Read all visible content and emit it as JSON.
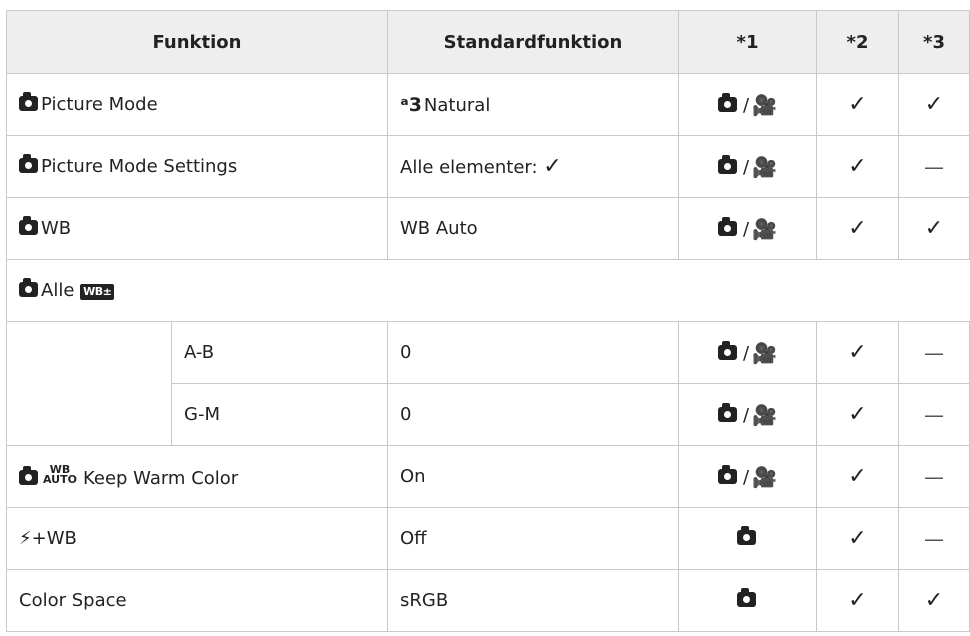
{
  "header": {
    "col1": "Funktion",
    "col2": "Standardfunktion",
    "col3": "*1",
    "col4": "*2",
    "col5": "*3"
  },
  "rows": {
    "picture_mode": {
      "label": "Picture Mode",
      "default_icon": "ᵃ3",
      "default_text": "Natural"
    },
    "picture_mode_settings": {
      "label": "Picture Mode Settings",
      "default_text": "Alle elementer:"
    },
    "wb": {
      "label": "WB",
      "default_text": "WB Auto"
    },
    "all_wb": {
      "label": "Alle",
      "icon_text": "WB±"
    },
    "ab": {
      "label": "A-B",
      "default_text": "0"
    },
    "gm": {
      "label": "G-M",
      "default_text": "0"
    },
    "keep_warm": {
      "auto_top": "WB",
      "auto_bottom": "AUTO",
      "label": "Keep Warm Color",
      "default_text": "On"
    },
    "flash_wb": {
      "label": "+WB",
      "default_text": "Off"
    },
    "color_space": {
      "label": "Color Space",
      "default_text": "sRGB"
    }
  },
  "icons": {
    "camera": "camera-icon",
    "movie": "movie-camera-icon",
    "check": "✓",
    "dash": "—",
    "slash": "/",
    "flash": "⚡"
  }
}
